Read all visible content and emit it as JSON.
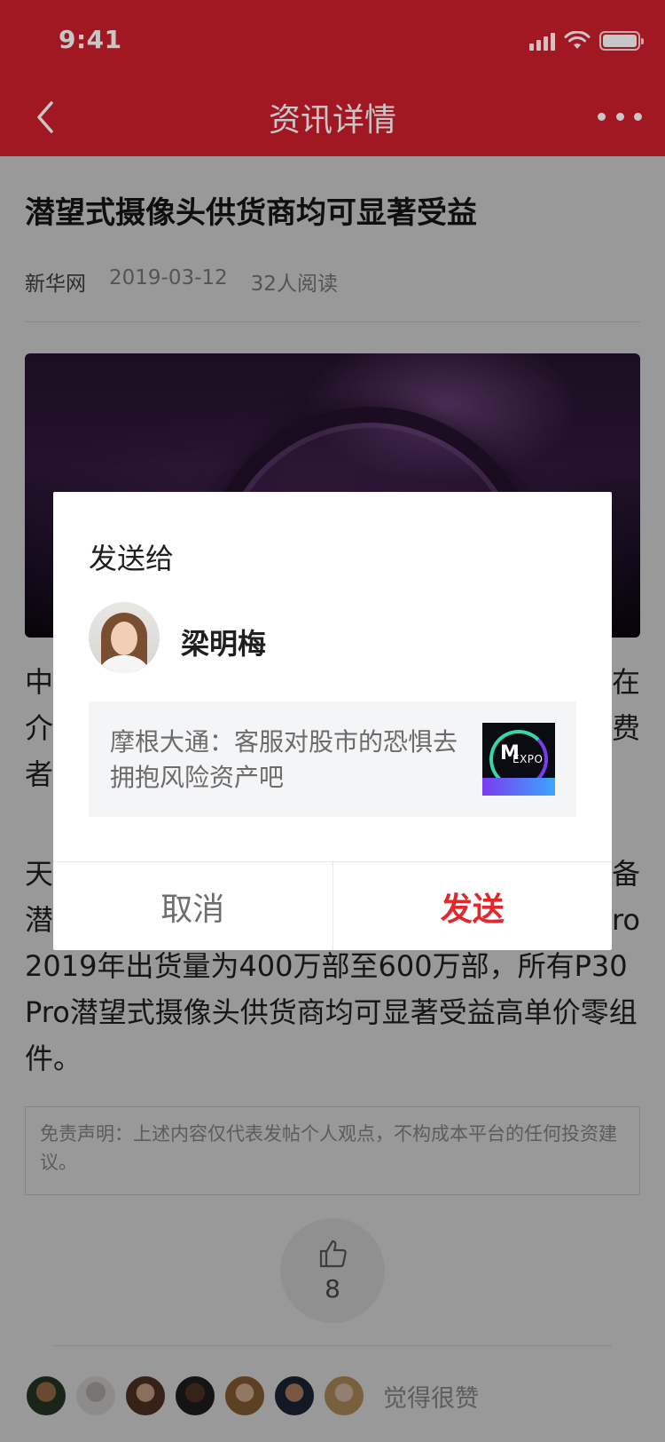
{
  "status_bar": {
    "time": "9:41"
  },
  "nav": {
    "title": "资讯详情"
  },
  "article": {
    "title": "潜望式摄像头供货商均可显著受益",
    "source": "新华网",
    "date": "2019-03-12",
    "reads": "32人阅读",
    "para1_line1": "中",
    "para1_line1_end": "在",
    "para1_line2": "介",
    "para1_line2_end": "费",
    "para1_line3": "者",
    "para2_line1": "天",
    "para2_line1_end": "备",
    "para2_line2": "潜",
    "para2_line2_end": "ro",
    "para2_line3": "2019年出货量为400万部至600万部，所有P30",
    "para2_line4": "Pro潜望式摄像头供货商均可显著受益高单价零组",
    "para2_line5": "件。",
    "disclaimer": "免责声明：上述内容仅代表发帖个人观点，不构成本平台的任何投资建议。"
  },
  "like": {
    "count": "8"
  },
  "likers": {
    "label": "觉得很赞"
  },
  "dialog": {
    "title": "发送给",
    "recipient_name": "梁明梅",
    "share_text": "摩根大通：客服对股市的恐惧去拥抱风险资产吧",
    "thumb_mark": "M",
    "thumb_word": "EXPO",
    "cancel_label": "取消",
    "send_label": "发送"
  },
  "colors": {
    "brand": "#cf1f2e",
    "send": "#e0282e"
  }
}
